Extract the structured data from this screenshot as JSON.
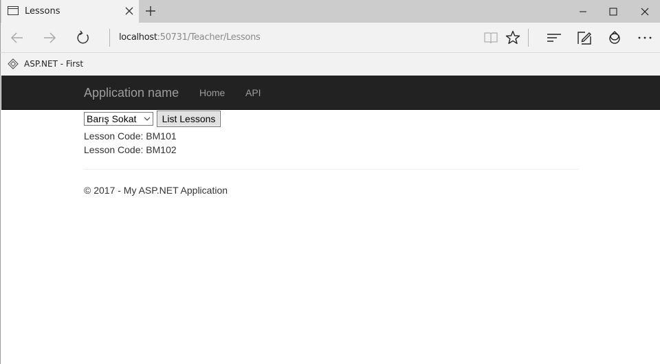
{
  "browser": {
    "tab": {
      "title": "Lessons"
    },
    "address": {
      "host": "localhost",
      "rest": ":50731/Teacher/Lessons"
    },
    "favorites": [
      {
        "label": "ASP.NET - First"
      }
    ],
    "icons": {
      "tab_page": "tab-page-icon",
      "close_tab": "close-icon",
      "new_tab": "plus-icon",
      "minimize": "minimize-icon",
      "maximize": "maximize-icon",
      "close_window": "close-icon",
      "back": "arrow-left-icon",
      "forward": "arrow-right-icon",
      "refresh": "refresh-icon",
      "reading_view": "book-icon",
      "favorite": "star-icon",
      "hub": "hub-icon",
      "web_note": "pen-note-icon",
      "share": "share-icon",
      "more": "more-icon"
    }
  },
  "app": {
    "brand": "Application name",
    "nav": [
      {
        "label": "Home"
      },
      {
        "label": "API"
      }
    ],
    "teacher_select": {
      "selected": "Barış Sokat"
    },
    "list_button": "List Lessons",
    "lessons": [
      {
        "text": "Lesson Code: BM101"
      },
      {
        "text": "Lesson Code: BM102"
      }
    ],
    "footer": "© 2017 - My ASP.NET Application"
  },
  "colors": {
    "navbar_bg": "#222222",
    "navbar_text": "#9d9d9d",
    "chrome_bg": "#f2f2f2",
    "tabstrip_bg": "#cccccc"
  }
}
